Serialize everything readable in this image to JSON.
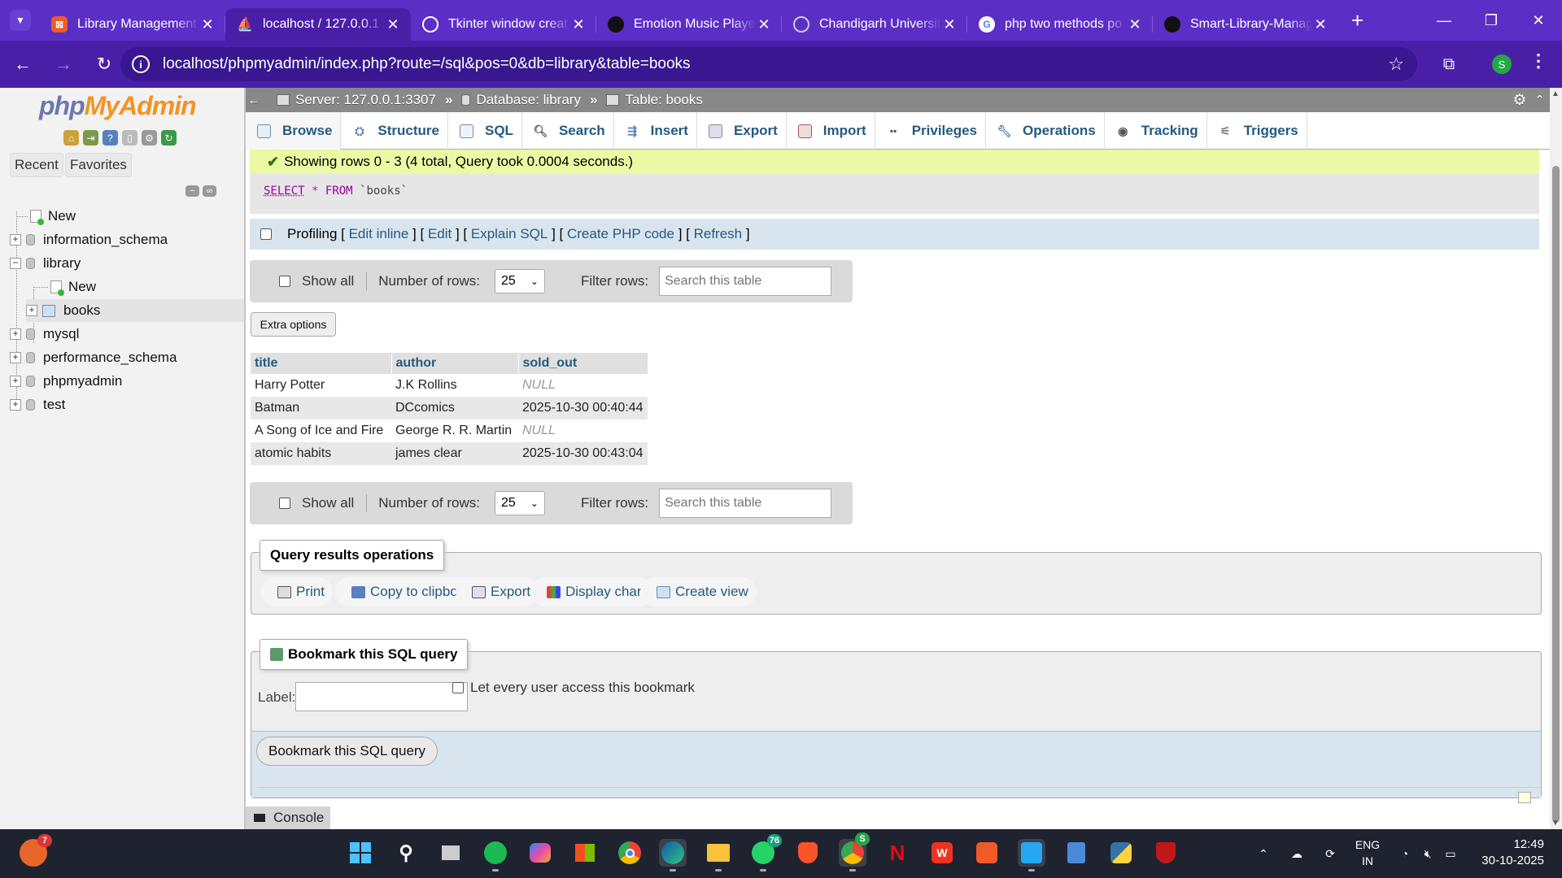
{
  "browser": {
    "tabs": [
      {
        "title": "Library Management",
        "icon": "xampp-icon",
        "color": "#f05a28",
        "active": false
      },
      {
        "title": "localhost / 127.0.0.1 / ",
        "icon": "phpmyadmin-sail-icon",
        "color": "#f29423",
        "active": true
      },
      {
        "title": "Tkinter window creat",
        "icon": "openai-icon",
        "color": "#5b2fc6",
        "active": false
      },
      {
        "title": "Emotion Music Playe",
        "icon": "github-icon",
        "color": "#111111",
        "active": false
      },
      {
        "title": "Chandigarh Universit",
        "icon": "globe-icon",
        "color": "#5b2fc6",
        "active": false
      },
      {
        "title": "php two methods po",
        "icon": "google-icon",
        "color": "#ffffff",
        "active": false
      },
      {
        "title": "Smart-Library-Manag",
        "icon": "github-icon",
        "color": "#111111",
        "active": false
      }
    ],
    "url": "localhost/phpmyadmin/index.php?route=/sql&pos=0&db=library&table=books",
    "profile_initial": "S"
  },
  "pma": {
    "logo": {
      "part1": "php",
      "part2": "MyAdmin"
    },
    "nav_buttons": {
      "recent": "Recent",
      "favorites": "Favorites"
    },
    "tree": {
      "new_top": "New",
      "dbs": [
        "information_schema",
        "library",
        "mysql",
        "performance_schema",
        "phpmyadmin",
        "test"
      ],
      "library_new": "New",
      "library_table": "books"
    },
    "breadcrumb": {
      "server": "Server: 127.0.0.1:3307",
      "database": "Database: library",
      "table": "Table: books"
    },
    "menu": [
      "Browse",
      "Structure",
      "SQL",
      "Search",
      "Insert",
      "Export",
      "Import",
      "Privileges",
      "Operations",
      "Tracking",
      "Triggers"
    ],
    "success": "Showing rows 0 - 3 (4 total, Query took 0.0004 seconds.)",
    "sql": {
      "select": "SELECT",
      "star": "*",
      "from": "FROM",
      "table": "`books`"
    },
    "profiling": {
      "label": "Profiling",
      "links": [
        "Edit inline",
        "Edit",
        "Explain SQL",
        "Create PHP code",
        "Refresh"
      ]
    },
    "nav_controls": {
      "show_all": "Show all",
      "num_rows_label": "Number of rows:",
      "num_rows": "25",
      "filter_label": "Filter rows:",
      "filter_placeholder": "Search this table"
    },
    "extra_options": "Extra options",
    "table": {
      "columns": [
        "title",
        "author",
        "sold_out"
      ],
      "rows": [
        [
          "Harry Potter",
          "J.K Rollins",
          "NULL"
        ],
        [
          "Batman",
          "DCcomics",
          "2025-10-30 00:40:44"
        ],
        [
          "A Song of Ice and Fire",
          "George R. R. Martin",
          "NULL"
        ],
        [
          "atomic habits",
          "james clear",
          "2025-10-30 00:43:04"
        ]
      ]
    },
    "ops": {
      "legend": "Query results operations",
      "buttons": [
        "Print",
        "Copy to clipboard",
        "Export",
        "Display chart",
        "Create view"
      ]
    },
    "bookmark": {
      "legend": "Bookmark this SQL query",
      "label": "Label:",
      "share": "Let every user access this bookmark",
      "submit": "Bookmark this SQL query"
    },
    "console": "Console"
  },
  "taskbar": {
    "apps": [
      "windows-start-icon",
      "search-icon",
      "task-view-icon",
      "spotify-icon",
      "copilot-icon",
      "store-icon",
      "chrome-icon",
      "edge-icon",
      "explorer-icon",
      "whatsapp-icon",
      "brave-icon",
      "chrome-profile-icon",
      "netflix-icon",
      "wps-icon",
      "xampp-icon",
      "vscode-icon",
      "notepad-icon",
      "python-icon",
      "mcafee-icon"
    ],
    "weather_badge": "7",
    "whatsapp_badge": "76",
    "lang": {
      "line1": "ENG",
      "line2": "IN"
    },
    "time": "12:49",
    "date": "30-10-2025"
  }
}
